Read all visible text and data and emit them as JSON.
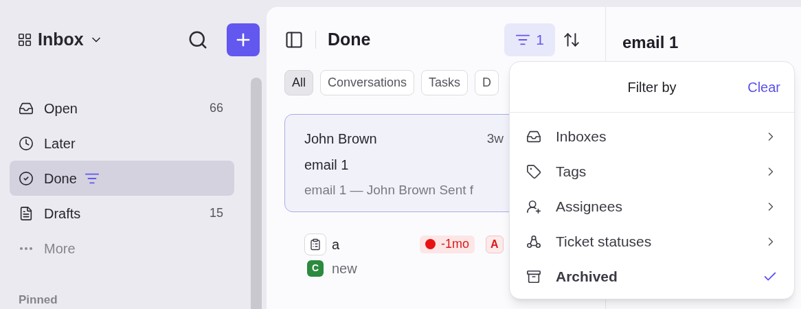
{
  "sidebar": {
    "title": "Inbox",
    "items": [
      {
        "label": "Open",
        "kind": "inbox",
        "count": "66",
        "selected": false,
        "filtered": false
      },
      {
        "label": "Later",
        "kind": "clock",
        "selected": false,
        "filtered": false
      },
      {
        "label": "Done",
        "kind": "done",
        "selected": true,
        "filtered": true
      },
      {
        "label": "Drafts",
        "kind": "draft",
        "count": "15",
        "selected": false,
        "filtered": false
      },
      {
        "label": "More",
        "kind": "more",
        "selected": false,
        "filtered": false
      }
    ],
    "section": "Pinned"
  },
  "list": {
    "title": "Done",
    "filter_count": "1",
    "tabs": [
      {
        "label": "All",
        "selected": true
      },
      {
        "label": "Conversations",
        "selected": false
      },
      {
        "label": "Tasks",
        "selected": false
      },
      {
        "label": "D",
        "selected": false
      }
    ],
    "items": [
      {
        "kind": "conversation",
        "selected": true,
        "name": "John Brown",
        "time": "3w",
        "subject": "email 1",
        "preview": "email 1 — John Brown Sent f"
      },
      {
        "kind": "task",
        "selected": false,
        "name": "a",
        "due": "-1mo",
        "assignee": "A",
        "tag_letter": "C",
        "tag": "new"
      }
    ]
  },
  "detail": {
    "title": "email 1"
  },
  "filter_menu": {
    "title": "Filter by",
    "clear": "Clear",
    "options": [
      {
        "label": "Inboxes",
        "kind": "inbox",
        "checked": false
      },
      {
        "label": "Tags",
        "kind": "tag",
        "checked": false
      },
      {
        "label": "Assignees",
        "kind": "assignee",
        "checked": false
      },
      {
        "label": "Ticket statuses",
        "kind": "status",
        "checked": false
      },
      {
        "label": "Archived",
        "kind": "archive",
        "checked": true
      }
    ]
  }
}
